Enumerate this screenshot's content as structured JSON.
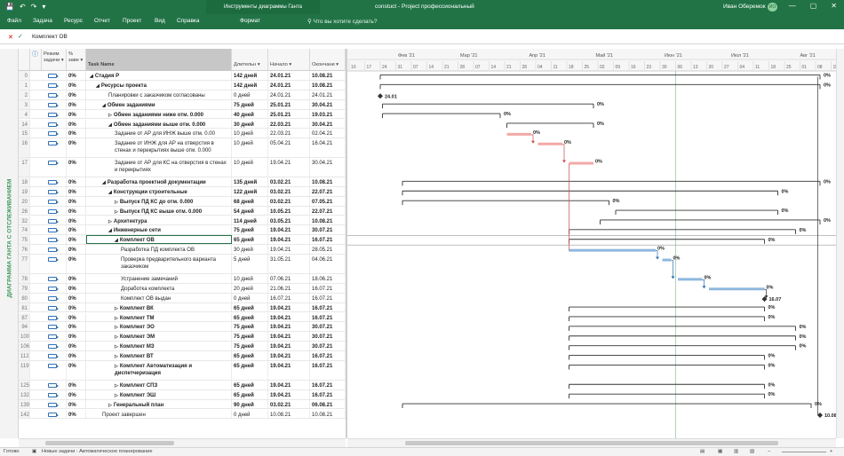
{
  "window": {
    "title": "constuct - Project профессиональный",
    "context_tab": "Инструменты диаграммы Ганта",
    "user": "Иван Оберемок",
    "avatar": "ИО",
    "controls": [
      "—",
      "▢",
      "✕"
    ]
  },
  "quick_access": [
    "💾",
    "↶",
    "↷",
    "▾"
  ],
  "menu": {
    "items": [
      "Файл",
      "Задача",
      "Ресурс",
      "Отчет",
      "Проект",
      "Вид",
      "Справка",
      "Формат"
    ],
    "tell_me": "Что вы хотите сделать?"
  },
  "formula": {
    "value": "Комплект ОВ"
  },
  "sidebar_label": "ДИАГРАММА ГАНТА С ОТСЛЕЖИВАНИЕМ",
  "grid": {
    "headers": {
      "info": "ⓘ",
      "mode": "Режим задачи ▾",
      "pct": "% заве ▾",
      "name": "Task Name",
      "dur": "Длительн ▾",
      "start": "Начало ▾",
      "fin": "Окончани ▾"
    },
    "rows": [
      {
        "id": "0",
        "pct": "0%",
        "name": "Стадия Р",
        "lvl": 0,
        "arrow": "◢",
        "bold": true,
        "dur": "142 дней",
        "start": "24.01.21",
        "fin": "10.08.21"
      },
      {
        "id": "1",
        "pct": "0%",
        "name": "Ресурсы проекта",
        "lvl": 1,
        "arrow": "◢",
        "bold": true,
        "dur": "142 дней",
        "start": "24.01.21",
        "fin": "10.08.21"
      },
      {
        "id": "2",
        "pct": "0%",
        "name": "Планировки с заказчиком согласованы",
        "lvl": 3,
        "arrow": "",
        "bold": false,
        "dur": "0 дней",
        "start": "24.01.21",
        "fin": "24.01.21"
      },
      {
        "id": "3",
        "pct": "0%",
        "name": "Обмен заданиями",
        "lvl": 2,
        "arrow": "◢",
        "bold": true,
        "dur": "75 дней",
        "start": "25.01.21",
        "fin": "30.04.21"
      },
      {
        "id": "4",
        "pct": "0%",
        "name": "Обмен заданиями ниже отм. 0.000",
        "lvl": 3,
        "arrow": "▷",
        "bold": true,
        "dur": "40 дней",
        "start": "25.01.21",
        "fin": "19.03.21"
      },
      {
        "id": "14",
        "pct": "0%",
        "name": "Обмен заданиями выше отм. 0.000",
        "lvl": 3,
        "arrow": "◢",
        "bold": true,
        "dur": "30 дней",
        "start": "22.03.21",
        "fin": "30.04.21"
      },
      {
        "id": "15",
        "pct": "0%",
        "name": "Задание от АР для ИНЖ выше отм. 0.00",
        "lvl": 4,
        "arrow": "",
        "bold": false,
        "dur": "10 дней",
        "start": "22.03.21",
        "fin": "02.04.21"
      },
      {
        "id": "16",
        "pct": "0%",
        "name": "Задание от ИНЖ для АР на отверстия в стенах и перекрытиях выше отм. 0.000",
        "lvl": 4,
        "arrow": "",
        "bold": false,
        "dur": "10 дней",
        "start": "05.04.21",
        "fin": "16.04.21",
        "h": 2
      },
      {
        "id": "17",
        "pct": "0%",
        "name": "Задание от АР для КС на отверстия в стенах и перекрытиях",
        "lvl": 4,
        "arrow": "",
        "bold": false,
        "dur": "10 дней",
        "start": "19.04.21",
        "fin": "30.04.21",
        "h": 2
      },
      {
        "id": "18",
        "pct": "0%",
        "name": "Разработка проектной документации",
        "lvl": 2,
        "arrow": "◢",
        "bold": true,
        "dur": "135 дней",
        "start": "03.02.21",
        "fin": "10.08.21"
      },
      {
        "id": "19",
        "pct": "0%",
        "name": "Конструкции строительные",
        "lvl": 3,
        "arrow": "◢",
        "bold": true,
        "dur": "122 дней",
        "start": "03.02.21",
        "fin": "22.07.21"
      },
      {
        "id": "20",
        "pct": "0%",
        "name": "Выпуск ПД КС до отм. 0.000",
        "lvl": 4,
        "arrow": "▷",
        "bold": true,
        "dur": "68 дней",
        "start": "03.02.21",
        "fin": "07.05.21"
      },
      {
        "id": "26",
        "pct": "0%",
        "name": "Выпуск ПД КС выше отм. 0.000",
        "lvl": 4,
        "arrow": "▷",
        "bold": true,
        "dur": "54 дней",
        "start": "10.05.21",
        "fin": "22.07.21"
      },
      {
        "id": "32",
        "pct": "0%",
        "name": "Архитектура",
        "lvl": 3,
        "arrow": "▷",
        "bold": true,
        "dur": "114 дней",
        "start": "03.05.21",
        "fin": "10.08.21"
      },
      {
        "id": "74",
        "pct": "0%",
        "name": "Инженерные сети",
        "lvl": 3,
        "arrow": "◢",
        "bold": true,
        "dur": "75 дней",
        "start": "19.04.21",
        "fin": "30.07.21"
      },
      {
        "id": "75",
        "pct": "0%",
        "name": "Комплект ОВ",
        "lvl": 4,
        "arrow": "◢",
        "bold": true,
        "dur": "65 дней",
        "start": "19.04.21",
        "fin": "16.07.21",
        "sel": true
      },
      {
        "id": "76",
        "pct": "0%",
        "name": "Разработка ПД комплекта ОВ",
        "lvl": 5,
        "arrow": "",
        "bold": false,
        "dur": "30 дней",
        "start": "19.04.21",
        "fin": "28.05.21"
      },
      {
        "id": "77",
        "pct": "0%",
        "name": "Проверка предварительного варианта заказчиком",
        "lvl": 5,
        "arrow": "",
        "bold": false,
        "dur": "5 дней",
        "start": "31.05.21",
        "fin": "04.06.21",
        "h": 2
      },
      {
        "id": "78",
        "pct": "0%",
        "name": "Устранение замечаний",
        "lvl": 5,
        "arrow": "",
        "bold": false,
        "dur": "10 дней",
        "start": "07.06.21",
        "fin": "18.06.21"
      },
      {
        "id": "79",
        "pct": "0%",
        "name": "Доработка комплекта",
        "lvl": 5,
        "arrow": "",
        "bold": false,
        "dur": "20 дней",
        "start": "21.06.21",
        "fin": "16.07.21"
      },
      {
        "id": "80",
        "pct": "0%",
        "name": "Комплект ОВ выдан",
        "lvl": 5,
        "arrow": "",
        "bold": false,
        "dur": "0 дней",
        "start": "16.07.21",
        "fin": "16.07.21"
      },
      {
        "id": "81",
        "pct": "0%",
        "name": "Комплект ВК",
        "lvl": 4,
        "arrow": "▷",
        "bold": true,
        "dur": "65 дней",
        "start": "19.04.21",
        "fin": "16.07.21"
      },
      {
        "id": "87",
        "pct": "0%",
        "name": "Комплект ТМ",
        "lvl": 4,
        "arrow": "▷",
        "bold": true,
        "dur": "65 дней",
        "start": "19.04.21",
        "fin": "16.07.21"
      },
      {
        "id": "94",
        "pct": "0%",
        "name": "Комплект ЭО",
        "lvl": 4,
        "arrow": "▷",
        "bold": true,
        "dur": "75 дней",
        "start": "19.04.21",
        "fin": "30.07.21"
      },
      {
        "id": "100",
        "pct": "0%",
        "name": "Комплект ЭМ",
        "lvl": 4,
        "arrow": "▷",
        "bold": true,
        "dur": "75 дней",
        "start": "19.04.21",
        "fin": "30.07.21"
      },
      {
        "id": "106",
        "pct": "0%",
        "name": "Комплект МЗ",
        "lvl": 4,
        "arrow": "▷",
        "bold": true,
        "dur": "75 дней",
        "start": "19.04.21",
        "fin": "30.07.21"
      },
      {
        "id": "112",
        "pct": "0%",
        "name": "Комплект ВТ",
        "lvl": 4,
        "arrow": "▷",
        "bold": true,
        "dur": "65 дней",
        "start": "19.04.21",
        "fin": "16.07.21"
      },
      {
        "id": "119",
        "pct": "0%",
        "name": "Комплект Автоматизация и диспетчеризация",
        "lvl": 4,
        "arrow": "▷",
        "bold": true,
        "dur": "65 дней",
        "start": "19.04.21",
        "fin": "16.07.21",
        "h": 2
      },
      {
        "id": "125",
        "pct": "0%",
        "name": "Комплект СПЗ",
        "lvl": 4,
        "arrow": "▷",
        "bold": true,
        "dur": "65 дней",
        "start": "19.04.21",
        "fin": "16.07.21"
      },
      {
        "id": "132",
        "pct": "0%",
        "name": "Комплект ЭШ",
        "lvl": 4,
        "arrow": "▷",
        "bold": true,
        "dur": "65 дней",
        "start": "19.04.21",
        "fin": "16.07.21"
      },
      {
        "id": "139",
        "pct": "0%",
        "name": "Генеральный план",
        "lvl": 3,
        "arrow": "▷",
        "bold": true,
        "dur": "90 дней",
        "start": "03.02.21",
        "fin": "06.08.21"
      },
      {
        "id": "142",
        "pct": "0%",
        "name": "Проект завершен",
        "lvl": 2,
        "arrow": "",
        "bold": false,
        "dur": "0 дней",
        "start": "10.08.21",
        "fin": "10.08.21"
      }
    ]
  },
  "timescale": {
    "months": [
      {
        "label": "Фев '21",
        "date": "2021-02-01"
      },
      {
        "label": "Мар '21",
        "date": "2021-03-01"
      },
      {
        "label": "Апр '21",
        "date": "2021-04-01"
      },
      {
        "label": "Май '21",
        "date": "2021-05-01"
      },
      {
        "label": "Июн '21",
        "date": "2021-06-01"
      },
      {
        "label": "Июл '21",
        "date": "2021-07-01"
      },
      {
        "label": "Авг '21",
        "date": "2021-08-01"
      }
    ],
    "days": [
      "10",
      "17",
      "24",
      "31",
      "07",
      "14",
      "21",
      "28",
      "07",
      "14",
      "21",
      "28",
      "04",
      "11",
      "18",
      "25",
      "02",
      "09",
      "16",
      "23",
      "30",
      "06",
      "13",
      "20",
      "27",
      "04",
      "11",
      "18",
      "25",
      "01",
      "08",
      "15"
    ],
    "date_axis": {
      "start": "2021-01-10",
      "end": "2021-08-16"
    },
    "status_line": "2021-06-06"
  },
  "gantt_items": [
    {
      "type": "summary",
      "start": "2021-01-24",
      "end": "2021-08-10",
      "label": "0%"
    },
    {
      "type": "summary",
      "start": "2021-01-24",
      "end": "2021-08-10",
      "label": "0%"
    },
    {
      "type": "milestone",
      "date": "2021-01-24",
      "label": "24.01"
    },
    {
      "type": "summary",
      "start": "2021-01-25",
      "end": "2021-04-30",
      "label": "0%"
    },
    {
      "type": "summary",
      "start": "2021-01-25",
      "end": "2021-03-19",
      "label": "0%"
    },
    {
      "type": "summary",
      "start": "2021-03-22",
      "end": "2021-04-30",
      "label": "0%"
    },
    {
      "type": "task",
      "start": "2021-03-22",
      "end": "2021-04-02",
      "label": "0%",
      "color": "#f2aaa6"
    },
    {
      "type": "task",
      "start": "2021-04-05",
      "end": "2021-04-16",
      "label": "0%",
      "color": "#f2aaa6"
    },
    {
      "type": "task",
      "start": "2021-04-19",
      "end": "2021-04-30",
      "label": "0%",
      "color": "#f2aaa6"
    },
    {
      "type": "summary",
      "start": "2021-02-03",
      "end": "2021-08-10",
      "label": "0%"
    },
    {
      "type": "summary",
      "start": "2021-02-03",
      "end": "2021-07-22",
      "label": "0%"
    },
    {
      "type": "summary",
      "start": "2021-02-03",
      "end": "2021-05-07",
      "label": "0%"
    },
    {
      "type": "summary",
      "start": "2021-05-10",
      "end": "2021-07-22",
      "label": "0%"
    },
    {
      "type": "summary",
      "start": "2021-05-03",
      "end": "2021-08-10",
      "label": "0%"
    },
    {
      "type": "summary",
      "start": "2021-04-19",
      "end": "2021-07-30",
      "label": "0%"
    },
    {
      "type": "summary",
      "start": "2021-04-19",
      "end": "2021-07-16",
      "label": "0%"
    },
    {
      "type": "task",
      "start": "2021-04-19",
      "end": "2021-05-28",
      "label": "0%",
      "color": "#8fb8de"
    },
    {
      "type": "task",
      "start": "2021-05-31",
      "end": "2021-06-04",
      "label": "0%",
      "color": "#8fb8de"
    },
    {
      "type": "task",
      "start": "2021-06-07",
      "end": "2021-06-18",
      "label": "0%",
      "color": "#8fb8de"
    },
    {
      "type": "task",
      "start": "2021-06-21",
      "end": "2021-07-16",
      "label": "0%",
      "color": "#8fb8de"
    },
    {
      "type": "milestone",
      "date": "2021-07-16",
      "label": "16.07"
    },
    {
      "type": "summary",
      "start": "2021-04-19",
      "end": "2021-07-16",
      "label": "0%"
    },
    {
      "type": "summary",
      "start": "2021-04-19",
      "end": "2021-07-16",
      "label": "0%"
    },
    {
      "type": "summary",
      "start": "2021-04-19",
      "end": "2021-07-30",
      "label": "0%"
    },
    {
      "type": "summary",
      "start": "2021-04-19",
      "end": "2021-07-30",
      "label": "0%"
    },
    {
      "type": "summary",
      "start": "2021-04-19",
      "end": "2021-07-30",
      "label": "0%"
    },
    {
      "type": "summary",
      "start": "2021-04-19",
      "end": "2021-07-16",
      "label": "0%"
    },
    {
      "type": "summary",
      "start": "2021-04-19",
      "end": "2021-07-16",
      "label": "0%"
    },
    {
      "type": "summary",
      "start": "2021-04-19",
      "end": "2021-07-16",
      "label": "0%"
    },
    {
      "type": "summary",
      "start": "2021-04-19",
      "end": "2021-07-16",
      "label": "0%"
    },
    {
      "type": "summary",
      "start": "2021-02-03",
      "end": "2021-08-06",
      "label": "0%"
    },
    {
      "type": "milestone",
      "date": "2021-08-10",
      "label": "10.08"
    }
  ],
  "status_bar": {
    "ready": "Готово",
    "new_tasks": "Новые задачи : Автоматическое планирование"
  },
  "colors": {
    "brand": "#217346",
    "summary": "#333333",
    "pink": "#f2aaa6",
    "blue": "#8fb8de",
    "link_red": "#c0504d",
    "link_blue": "#2f6fb3"
  }
}
